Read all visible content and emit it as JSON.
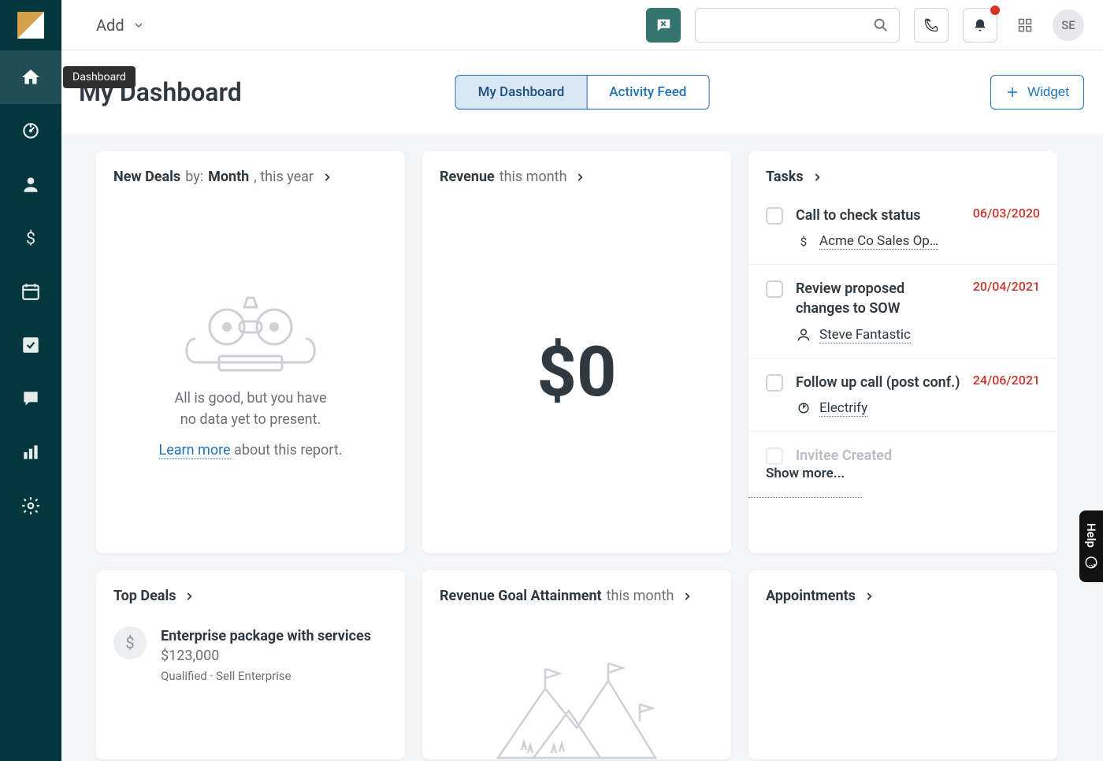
{
  "topbar": {
    "add_label": "Add",
    "avatar_initials": "SE"
  },
  "sidebar": {
    "tooltip_home": "Dashboard"
  },
  "header": {
    "title": "My Dashboard",
    "tabs": [
      {
        "label": "My Dashboard",
        "active": true
      },
      {
        "label": "Activity Feed",
        "active": false
      }
    ],
    "widget_button": "Widget"
  },
  "cards": {
    "new_deals": {
      "title_strong": "New Deals",
      "title_mid": "by:",
      "title_strong2": "Month",
      "title_tail": ", this year",
      "empty_line1": "All is good, but you have",
      "empty_line2": "no data yet to present.",
      "learn_more": "Learn more",
      "about_report": " about this report."
    },
    "revenue": {
      "title_strong": "Revenue",
      "title_tail": "this month",
      "value": "$0"
    },
    "tasks": {
      "title": "Tasks",
      "show_more": "Show more...",
      "items": [
        {
          "title": "Call to check status",
          "date": "06/03/2020",
          "icon": "dollar",
          "sub": "Acme Co Sales Op…"
        },
        {
          "title": "Review proposed changes to SOW",
          "date": "20/04/2021",
          "icon": "person",
          "sub": "Steve Fantastic"
        },
        {
          "title": "Follow up call (post conf.)",
          "date": "24/06/2021",
          "icon": "lead",
          "sub": "Electrify"
        },
        {
          "title": "Invitee Created",
          "date": "",
          "icon": "",
          "sub": "",
          "faded": true
        }
      ]
    },
    "top_deals": {
      "title": "Top Deals",
      "deal": {
        "title": "Enterprise package with services",
        "amount": "$123,000",
        "sub": "Qualified · Sell Enterprise"
      }
    },
    "revenue_goal": {
      "title_strong": "Revenue Goal Attainment",
      "title_tail": "this month"
    },
    "appointments": {
      "title": "Appointments"
    }
  },
  "help_tab": "Help"
}
